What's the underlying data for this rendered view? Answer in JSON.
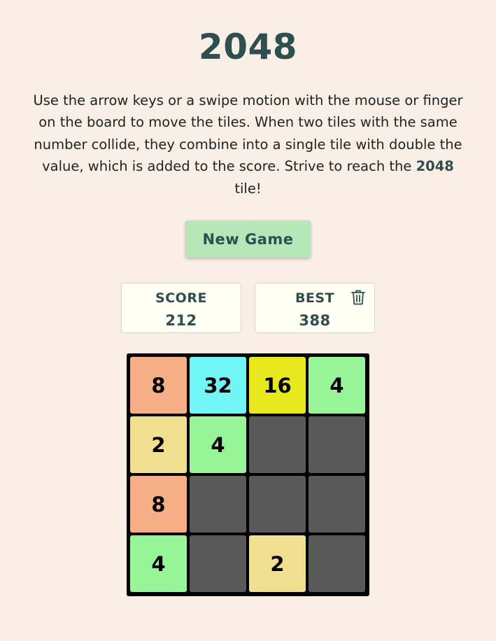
{
  "title": "2048",
  "instructions": {
    "text_before": "Use the arrow keys or a swipe motion with the mouse or finger on the board to move the tiles. When two tiles with the same number collide, they combine into a single tile with double the value, which is added to the score. Strive to reach the ",
    "highlight": "2048",
    "text_after": " tile!"
  },
  "new_game_label": "New Game",
  "score": {
    "label": "SCORE",
    "value": "212"
  },
  "best": {
    "label": "BEST",
    "value": "388",
    "reset_icon": "trash-icon"
  },
  "colors": {
    "background": "#faefe6",
    "text": "#2e4f4f",
    "button": "#b6e7b9",
    "empty_cell": "#595959",
    "board": "#000000",
    "tile_2": "#f0df8f",
    "tile_4": "#98f597",
    "tile_8": "#f5ae85",
    "tile_16": "#e8e81e",
    "tile_32": "#72f5f5"
  },
  "board": [
    [
      "8",
      "32",
      "16",
      "4"
    ],
    [
      "2",
      "4",
      "",
      ""
    ],
    [
      "8",
      "",
      "",
      ""
    ],
    [
      "4",
      "",
      "2",
      ""
    ]
  ]
}
